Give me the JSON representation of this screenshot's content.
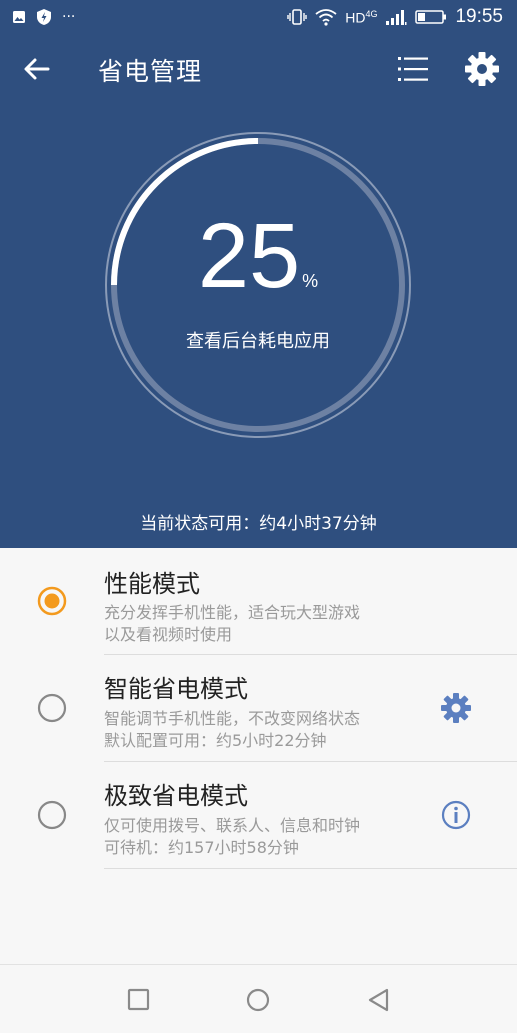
{
  "status_bar": {
    "time": "19:55",
    "network": "HD",
    "network_gen": "4G",
    "more": "···"
  },
  "header": {
    "title": "省电管理"
  },
  "gauge": {
    "percent": 25,
    "value": "25",
    "unit": "%",
    "label": "查看后台耗电应用"
  },
  "status_text": "当前状态可用：约4小时37分钟",
  "modes": [
    {
      "title": "性能模式",
      "lines": [
        "充分发挥手机性能，适合玩大型游戏",
        "以及看视频时使用"
      ],
      "selected": true
    },
    {
      "title": "智能省电模式",
      "lines": [
        "智能调节手机性能，不改变网络状态",
        "默认配置可用：约5小时22分钟"
      ],
      "selected": false,
      "icon": "gear-icon"
    },
    {
      "title": "极致省电模式",
      "lines": [
        "仅可使用拨号、联系人、信息和时钟",
        "可待机：约157小时58分钟"
      ],
      "selected": false,
      "icon": "info-icon"
    }
  ],
  "colors": {
    "primary": "#2f4f7f",
    "accent": "#f39a1e",
    "icon_blue": "#5b7fc0"
  }
}
